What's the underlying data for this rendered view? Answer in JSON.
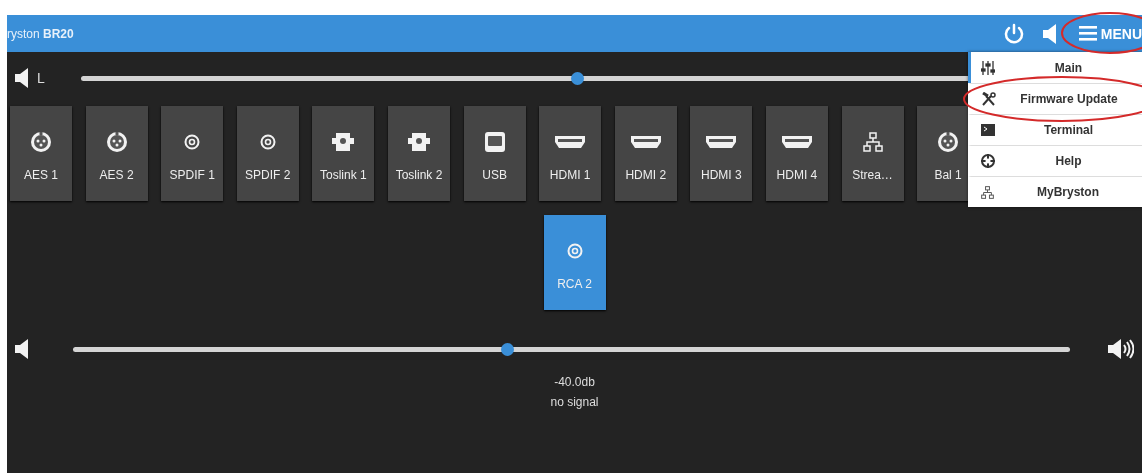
{
  "header": {
    "title": "ryston **BR20**",
    "menu_label": "MENU",
    "menu_circled": true
  },
  "balance": {
    "label": "L",
    "level": 0.5
  },
  "input_rows": [
    {
      "inputs": [
        {
          "label": "AES 1",
          "kind": "xlr",
          "selected": false
        },
        {
          "label": "AES 2",
          "kind": "xlr",
          "selected": false
        },
        {
          "label": "SPDIF 1",
          "kind": "coax",
          "selected": false
        },
        {
          "label": "SPDIF 2",
          "kind": "coax",
          "selected": false
        },
        {
          "label": "Toslink 1",
          "kind": "optical",
          "selected": false
        },
        {
          "label": "Toslink 2",
          "kind": "optical",
          "selected": false
        },
        {
          "label": "USB",
          "kind": "usb",
          "selected": false
        },
        {
          "label": "HDMI 1",
          "kind": "hdmi",
          "selected": false
        },
        {
          "label": "HDMI 2",
          "kind": "hdmi",
          "selected": false
        },
        {
          "label": "HDMI 3",
          "kind": "hdmi",
          "selected": false
        },
        {
          "label": "HDMI 4",
          "kind": "hdmi",
          "selected": false
        },
        {
          "label": "Strea…",
          "kind": "network",
          "selected": false
        },
        {
          "label": "Bal 1",
          "kind": "xlr",
          "selected": false
        }
      ]
    },
    {
      "inputs": [
        {
          "label": "RCA 2",
          "kind": "coax",
          "selected": true
        }
      ]
    }
  ],
  "menu": {
    "items": [
      {
        "label": "Main",
        "kind": "sliders",
        "selected": true,
        "circled": false
      },
      {
        "label": "Firmware Update",
        "kind": "tools",
        "selected": false,
        "circled": true
      },
      {
        "label": "Terminal",
        "kind": "terminal",
        "selected": false,
        "circled": false
      },
      {
        "label": "Help",
        "kind": "lifebuoy",
        "selected": false,
        "circled": false
      },
      {
        "label": "MyBryston",
        "kind": "network",
        "selected": false,
        "circled": false
      }
    ]
  },
  "volume": {
    "level": 0.435,
    "reading": "-40.0db",
    "status": "no signal"
  }
}
